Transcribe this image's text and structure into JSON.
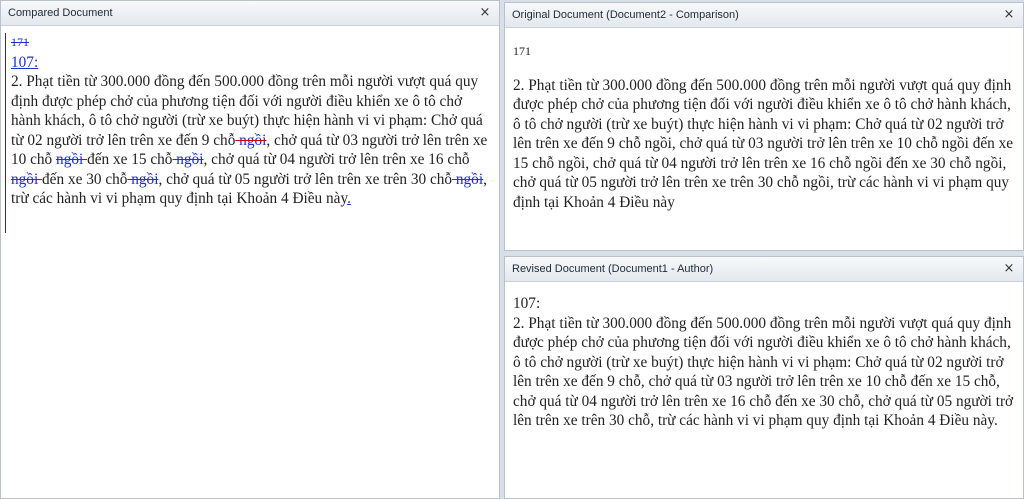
{
  "compared": {
    "title": "Compared Document",
    "deleted_header": "171",
    "inserted_header": "107:",
    "seg1": "2. Phạt tiền từ 300.000 đồng đến 500.000 đồng trên mỗi người vượt quá quy định được phép chở của phương tiện đối với người điều khiển xe ô tô chở hành khách, ô tô chở người (trừ xe buýt) thực hiện hành vi vi phạm: Chở quá từ 02 người trở lên trên xe đến 9 chỗ",
    "del1": " ngồi",
    "seg2": ", chở quá từ 03 người trở lên trên xe 10 chỗ ",
    "del2": "ngồi ",
    "seg3": "đến xe 15 chỗ",
    "del3": " ngồi",
    "seg4": ", chở quá từ 04 người trở lên trên xe 16 chỗ ",
    "del4": "ngồi ",
    "seg5": "đến xe 30 chỗ",
    "del5": " ngồi",
    "seg6": ", chở quá từ 05 người trở lên trên xe trên 30 chỗ",
    "del6": " ngồi",
    "seg7": ", trừ các hành vi vi phạm quy định tại Khoản 4 Điều này",
    "ins_end": "."
  },
  "original": {
    "title": "Original Document (Document2 - Comparison)",
    "line_number": "171",
    "text": "2. Phạt tiền từ 300.000 đồng đến 500.000 đồng trên mỗi người vượt quá quy định được phép chở của phương tiện đối với người điều khiển xe ô tô chở hành khách, ô tô chở người (trừ xe buýt) thực hiện hành vi vi phạm: Chở quá từ 02 người trở lên trên xe đến 9 chỗ ngồi, chở quá từ 03 người trở lên trên xe 10 chỗ ngồi đến xe 15 chỗ ngồi, chở quá từ 04 người trở lên trên xe 16 chỗ ngồi đến xe 30 chỗ ngồi, chở quá từ 05 người trở lên trên xe trên 30 chỗ ngồi, trừ các hành vi vi phạm quy định tại Khoản 4 Điều này"
  },
  "revised": {
    "title": "Revised Document (Document1 - Author)",
    "line_number": "107:",
    "text": "2. Phạt tiền từ 300.000 đồng đến 500.000 đồng trên mỗi người vượt quá quy định được phép chở của phương tiện đối với người điều khiển xe ô tô chở hành khách, ô tô chở người (trừ xe buýt) thực hiện hành vi vi phạm: Chở quá từ 02 người trở lên trên xe đến 9 chỗ, chở quá từ 03 người trở lên trên xe 10 chỗ đến xe 15 chỗ, chở quá từ 04 người trở lên trên xe 16 chỗ đến xe 30 chỗ, chở quá từ 05 người trở lên trên xe trên 30 chỗ, trừ các hành vi vi phạm quy định tại Khoản 4 Điều này."
  },
  "icons": {
    "close": "×"
  }
}
